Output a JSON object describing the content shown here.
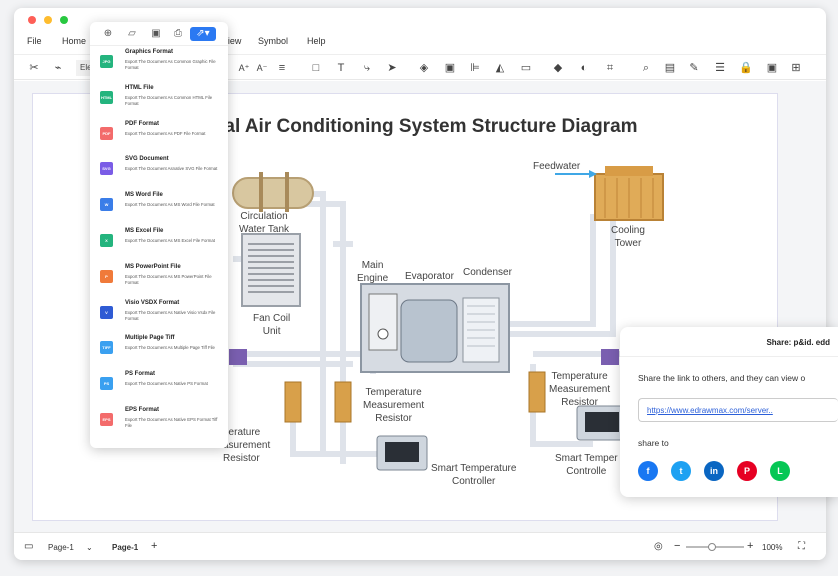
{
  "menu": [
    "File",
    "Home",
    "View",
    "Symbol",
    "Help"
  ],
  "toolbar_partial": "Ele",
  "diagram": {
    "title": "Central Air Conditioning System Structure Diagram",
    "title_visible": "ral Air Conditioning System Structure Diagram",
    "labels": {
      "feedwater": "Feedwater",
      "circulation_tank": "Circulation\nWater Tank",
      "cooling_tower": "Cooling\nTower",
      "main_engine": "Main\nEngine",
      "evaporator": "Evaporator",
      "condenser": "Condenser",
      "fan_coil": "Fan Coil\nUnit",
      "temp_resistor_left": "perature\nasurement\nResistor",
      "temp_resistor_mid": "Temperature\nMeasurement\nResistor",
      "temp_resistor_right": "Temperature\nMeasurement\nResistor",
      "smart_controller_mid": "Smart Temperature\nController",
      "smart_controller_right": "Smart Temper\nControlle"
    }
  },
  "export_menu": {
    "items": [
      {
        "title": "Graphics Format",
        "desc": "Export The Document As Common Graphic File Format",
        "icon": "JPG",
        "color": "#24b47e"
      },
      {
        "title": "HTML File",
        "desc": "Export The Document As Common HTML File Format",
        "icon": "HTML",
        "color": "#24b47e"
      },
      {
        "title": "PDF Format",
        "desc": "Export The Document As PDF File Format",
        "icon": "PDF",
        "color": "#f36b6b"
      },
      {
        "title": "SVG Document",
        "desc": "Export The Document Asnative SVG File Format",
        "icon": "SVG",
        "color": "#7a5ce6"
      },
      {
        "title": "MS Word File",
        "desc": "Export The Document As MS Word File Format",
        "icon": "W",
        "color": "#3a7de8"
      },
      {
        "title": "MS Excel File",
        "desc": "Export The Document As MS Excel File Format",
        "icon": "X",
        "color": "#24b47e"
      },
      {
        "title": "MS PowerPoint File",
        "desc": "Export The Document As MS PowerPoint File Format",
        "icon": "P",
        "color": "#f07a3a"
      },
      {
        "title": "Visio VSDX Format",
        "desc": "Export The Document As Native Visio Vsdx File Format",
        "icon": "V",
        "color": "#2f5bd4"
      },
      {
        "title": "Multiple Page Tiff",
        "desc": "Export The Document As Multiple Page Tiff File",
        "icon": "TIFF",
        "color": "#3aa0f0"
      },
      {
        "title": "PS Format",
        "desc": "Export The Document As Native PS Format",
        "icon": "PS",
        "color": "#3aa0f0"
      },
      {
        "title": "EPS Format",
        "desc": "Export The Document As Native EPS Format Tiff File",
        "icon": "EPS",
        "color": "#f36b6b"
      }
    ]
  },
  "share": {
    "header": "Share: p&id. edd",
    "message": "Share the link to others, and they can view o",
    "url": "https://www.edrawmax.com/server..",
    "share_to": "share to",
    "socials": [
      {
        "name": "facebook",
        "glyph": "f",
        "color": "#1877f2"
      },
      {
        "name": "twitter",
        "glyph": "t",
        "color": "#1da1f2"
      },
      {
        "name": "linkedin",
        "glyph": "in",
        "color": "#0a66c2"
      },
      {
        "name": "pinterest",
        "glyph": "P",
        "color": "#e60023"
      },
      {
        "name": "line",
        "glyph": "L",
        "color": "#06c755"
      }
    ]
  },
  "status": {
    "page_selector": "Page-1",
    "page_tab": "Page-1",
    "add": "+",
    "zoom_minus": "−",
    "zoom_plus": "+",
    "zoom": "100%"
  }
}
